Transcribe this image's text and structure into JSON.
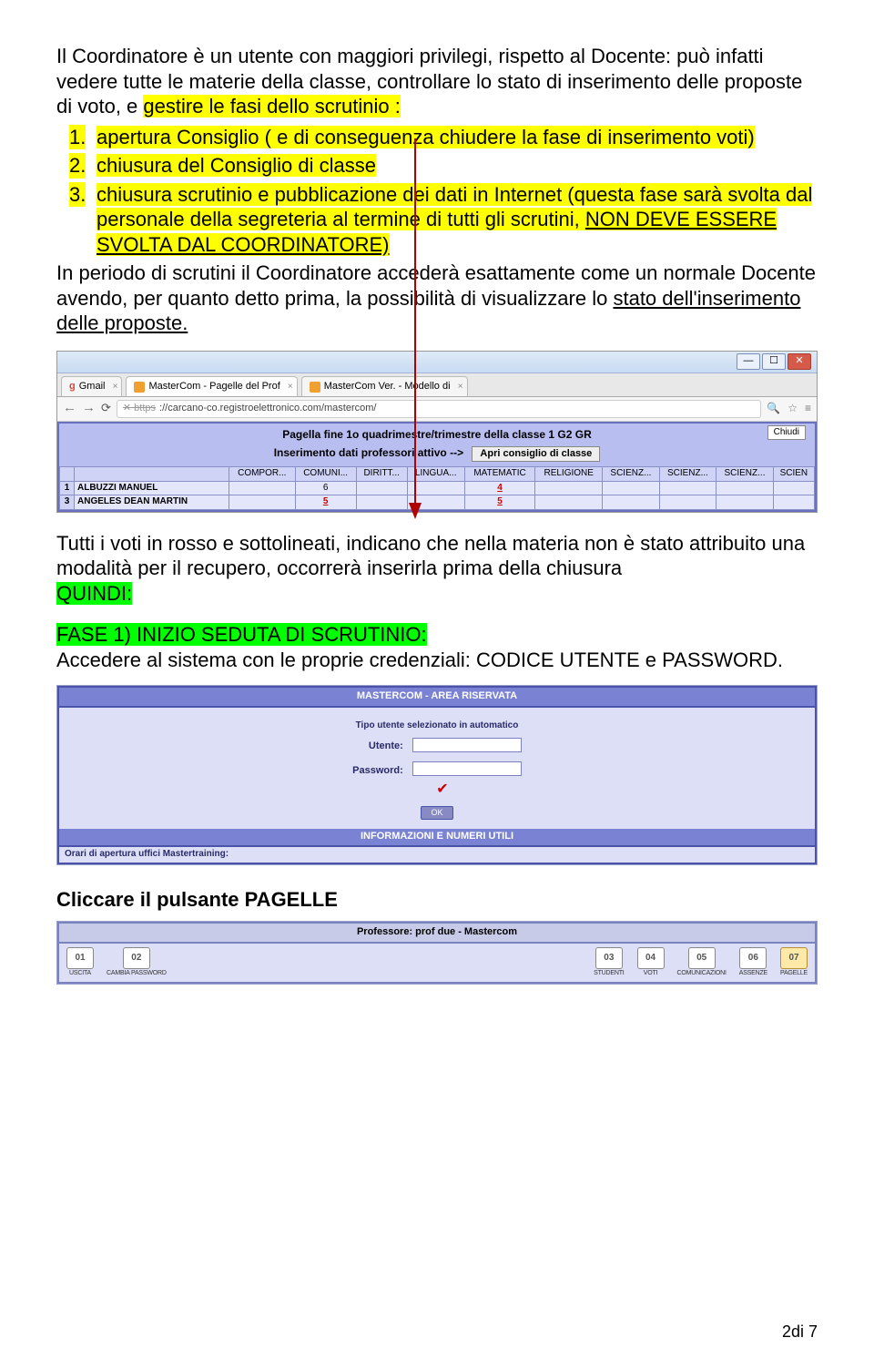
{
  "para1": {
    "t0": "Il Coordinatore è un utente con maggiori privilegi, rispetto al Docente: può infatti vedere tutte le materie della classe, controllare lo stato di inserimento delle proposte di voto, e ",
    "h1": "gestire le fasi dello scrutinio :",
    "li1": "apertura Consiglio ( e di conseguenza chiudere la fase di inserimento voti)",
    "li2": "chiusura del Consiglio di classe",
    "li3a": "chiusura scrutinio e pubblicazione dei dati in Internet (questa fase sarà svolta dal personale della segreteria al termine di tutti gli scrutini, ",
    "li3b": "NON DEVE ESSERE SVOLTA DAL COORDINATORE)",
    "t2": "In periodo di scrutini il Coordinatore accederà esattamente come un normale Docente avendo, per quanto detto prima, la possibilità di visualizzare lo ",
    "t3": "stato dell'inserimento delle proposte."
  },
  "shot1": {
    "tabs": {
      "t1": "Gmail",
      "t2": "MasterCom - Pagelle del Prof",
      "t3": "MasterCom Ver. - Modello di"
    },
    "url_pre": "✕ bttps",
    "url": "://carcano-co.registroelettronico.com/mastercom/",
    "close": "Chiudi",
    "hdr": "Pagella fine 1o quadrimestre/trimestre della classe 1 G2 GR",
    "sub_a": "Inserimento dati professori attivo -->",
    "sub_b": "Apri consiglio di classe",
    "cols": [
      "COMPOR...",
      "COMUNI...",
      "DIRITT...",
      "LINGUA...",
      "MATEMATIC",
      "RELIGIONE",
      "SCIENZ...",
      "SCIENZ...",
      "SCIENZ...",
      "SCIEN"
    ],
    "rows": [
      {
        "idx": "1",
        "name": "ALBUZZI MANUEL",
        "v": [
          "",
          "6",
          "",
          "",
          "4",
          "",
          "",
          "",
          "",
          ""
        ]
      },
      {
        "idx": "3",
        "name": "ANGELES DEAN MARTIN",
        "v": [
          "",
          "5",
          "",
          "",
          "5",
          "",
          "",
          "",
          "",
          ""
        ]
      }
    ]
  },
  "para2": {
    "t0": "Tutti i voti in rosso e sottolineati, indicano che nella materia non è stato attribuito una modalità per il recupero, occorrerà inserirla prima della chiusura",
    "h0": " QUINDI:",
    "h1": "FASE 1) INIZIO SEDUTA DI SCRUTINIO:",
    "t1": "Accedere al sistema con le proprie credenziali: CODICE UTENTE e PASSWORD."
  },
  "shot2": {
    "title": "MASTERCOM - AREA RISERVATA",
    "auto": "Tipo utente selezionato in automatico",
    "user": "Utente:",
    "pass": "Password:",
    "ok": "OK",
    "info1": "INFORMAZIONI E NUMERI UTILI",
    "info2": "Orari di apertura uffici Mastertraining:"
  },
  "para3": {
    "t0": "Cliccare il pulsante PAGELLE"
  },
  "shot3": {
    "title": "Professore: prof due - Mastercom",
    "tools": [
      {
        "id": "01",
        "lbl": "USCITA"
      },
      {
        "id": "02",
        "lbl": "CAMBIA PASSWORD"
      },
      {
        "id": "03",
        "lbl": "STUDENTI"
      },
      {
        "id": "04",
        "lbl": "VOTI"
      },
      {
        "id": "05",
        "lbl": "COMUNICAZIONI"
      },
      {
        "id": "06",
        "lbl": "ASSENZE"
      },
      {
        "id": "07",
        "lbl": "PAGELLE"
      }
    ]
  },
  "page_num": "2di 7"
}
